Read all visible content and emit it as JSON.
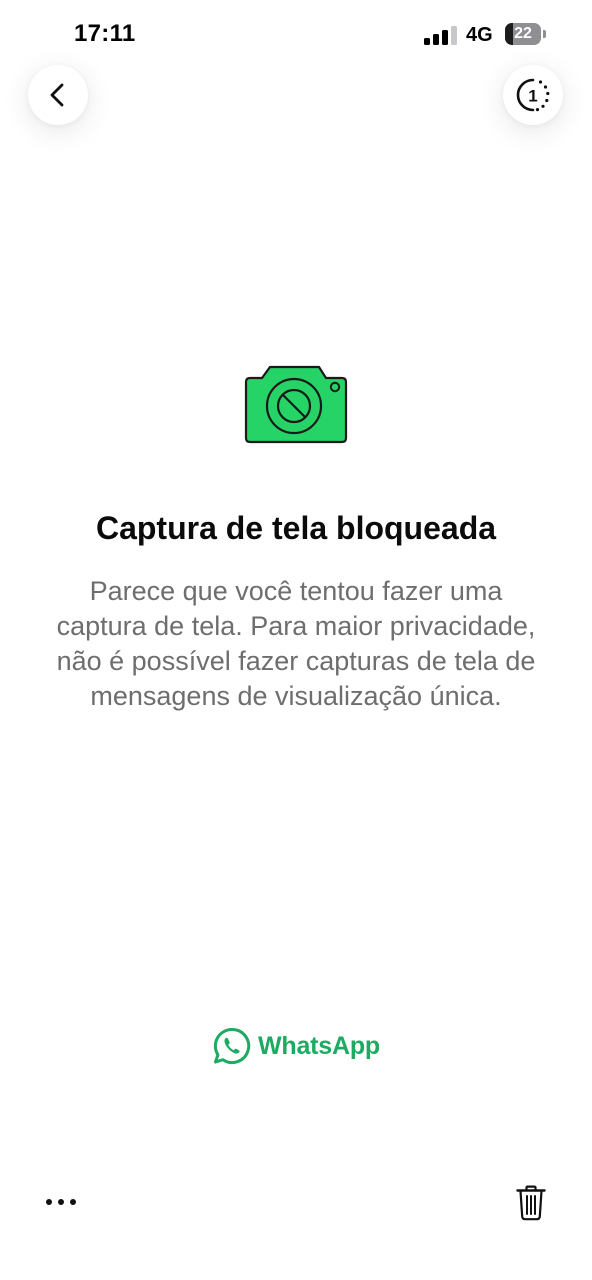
{
  "status_bar": {
    "time": "17:11",
    "network": "4G",
    "battery_level": "22",
    "battery_fraction": 0.22
  },
  "nav": {
    "back_icon": "chevron-left-icon",
    "view_once_icon": "view-once-icon",
    "view_once_label": "1"
  },
  "content": {
    "icon": "camera-blocked-icon",
    "title": "Captura de tela bloqueada",
    "description": "Parece que você tentou fazer uma captura de tela. Para maior privacidade, não é possível fazer capturas de tela de mensagens de visualização única."
  },
  "brand": {
    "name": "WhatsApp",
    "icon": "whatsapp-logo-icon"
  },
  "bottom_bar": {
    "more_icon": "more-horizontal-icon",
    "delete_icon": "trash-icon"
  },
  "colors": {
    "accent_green": "#25D366",
    "brand_green": "#1DAA61",
    "text_primary": "#0B0B0B",
    "text_secondary": "#6E6E6E"
  }
}
